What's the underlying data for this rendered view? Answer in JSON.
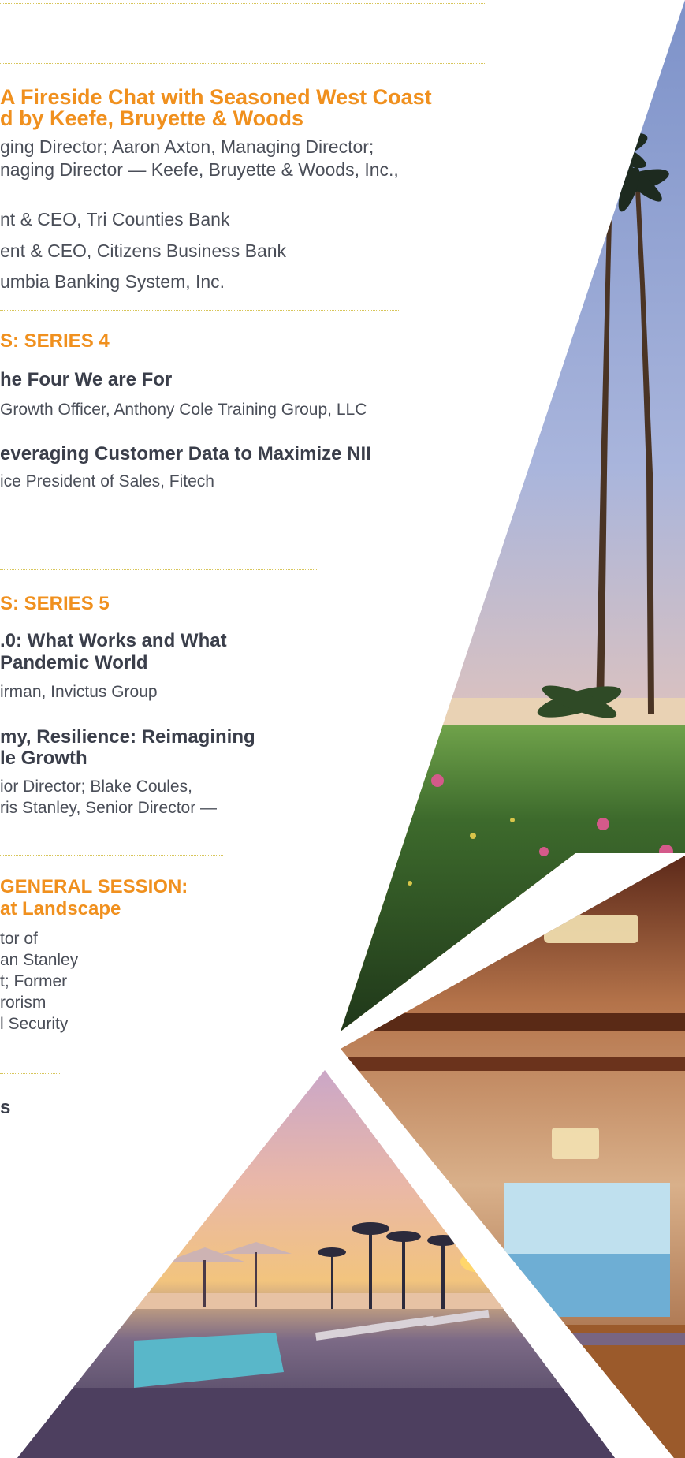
{
  "section1": {
    "title_line1": "A Fireside Chat with Seasoned West Coast",
    "title_line2": "d by Keefe, Bruyette & Woods",
    "line1": "ging Director; Aaron Axton, Managing Director;",
    "line2": "naging Director — Keefe, Bruyette & Woods, Inc.,",
    "line3": "nt & CEO, Tri Counties Bank",
    "line4": "ent & CEO, Citizens Business Bank",
    "line5": "umbia Banking System, Inc."
  },
  "series4": {
    "heading": "S: SERIES 4",
    "session1_title": "he Four We are For",
    "session1_speaker": "Growth Officer, Anthony Cole Training Group, LLC",
    "session2_title": "everaging Customer Data to Maximize NII",
    "session2_speaker": "ice President of Sales, Fitech"
  },
  "series5": {
    "heading": "S: SERIES 5",
    "session1_title_line1": ".0: What Works and What",
    "session1_title_line2": "Pandemic World",
    "session1_speaker": "irman, Invictus Group",
    "session2_title_line1": "my, Resilience: Reimagining",
    "session2_title_line2": "le Growth",
    "session2_speaker_line1": "ior Director; Blake Coules,",
    "session2_speaker_line2": "ris Stanley, Senior Director —"
  },
  "general": {
    "heading_line1": "GENERAL SESSION:",
    "heading_line2": "at Landscape",
    "line1": "tor of",
    "line2": "an Stanley",
    "line3": "t; Former",
    "line4": "rorism",
    "line5": "l Security"
  },
  "last": {
    "fragment": "s"
  },
  "colors": {
    "accent_orange": "#f0901e",
    "rule_gold": "#d8c65b",
    "text_dark": "#3a3e4a"
  }
}
